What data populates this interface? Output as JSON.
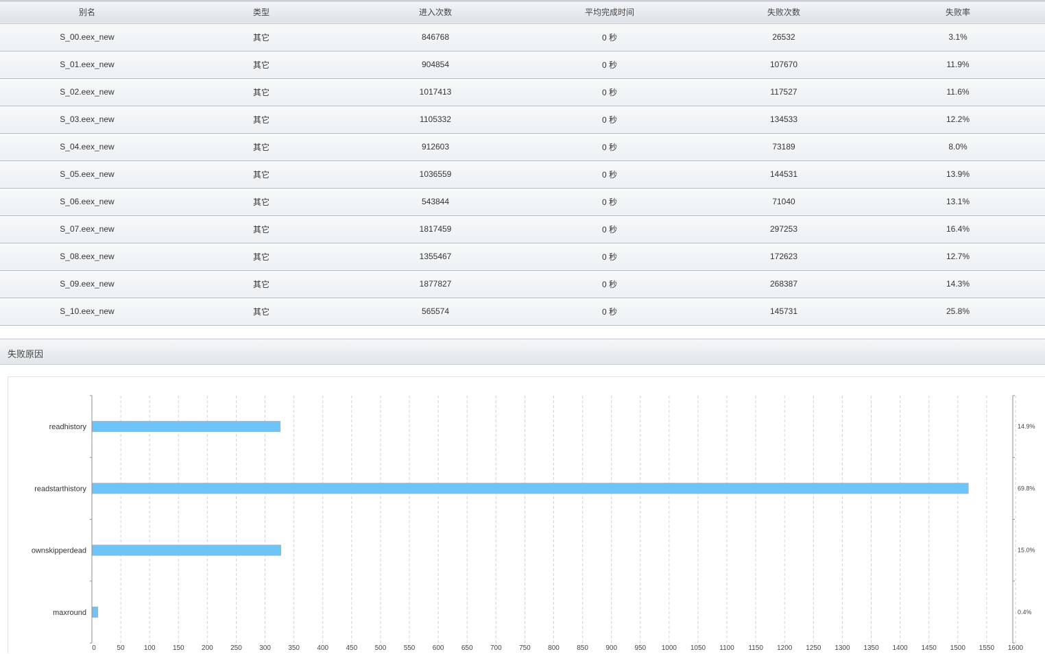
{
  "table": {
    "headers": [
      "别名",
      "类型",
      "进入次数",
      "平均完成时间",
      "失败次数",
      "失败率"
    ],
    "rows": [
      [
        "S_00.eex_new",
        "其它",
        "846768",
        "0 秒",
        "26532",
        "3.1%"
      ],
      [
        "S_01.eex_new",
        "其它",
        "904854",
        "0 秒",
        "107670",
        "11.9%"
      ],
      [
        "S_02.eex_new",
        "其它",
        "1017413",
        "0 秒",
        "117527",
        "11.6%"
      ],
      [
        "S_03.eex_new",
        "其它",
        "1105332",
        "0 秒",
        "134533",
        "12.2%"
      ],
      [
        "S_04.eex_new",
        "其它",
        "912603",
        "0 秒",
        "73189",
        "8.0%"
      ],
      [
        "S_05.eex_new",
        "其它",
        "1036559",
        "0 秒",
        "144531",
        "13.9%"
      ],
      [
        "S_06.eex_new",
        "其它",
        "543844",
        "0 秒",
        "71040",
        "13.1%"
      ],
      [
        "S_07.eex_new",
        "其它",
        "1817459",
        "0 秒",
        "297253",
        "16.4%"
      ],
      [
        "S_08.eex_new",
        "其它",
        "1355467",
        "0 秒",
        "172623",
        "12.7%"
      ],
      [
        "S_09.eex_new",
        "其它",
        "1877827",
        "0 秒",
        "268387",
        "14.3%"
      ],
      [
        "S_10.eex_new",
        "其它",
        "565574",
        "0 秒",
        "145731",
        "25.8%"
      ]
    ]
  },
  "section": {
    "title": "失败原因"
  },
  "chart_data": {
    "type": "bar",
    "orientation": "horizontal",
    "categories": [
      "readhistory",
      "readstarthistory",
      "ownskipperdead",
      "maxround"
    ],
    "values": [
      325,
      1517,
      326,
      9
    ],
    "percent_labels": [
      "14.9%",
      "69.8%",
      "15.0%",
      "0.4%"
    ],
    "xlim": [
      0,
      1600
    ],
    "xticks": [
      0,
      50,
      100,
      150,
      200,
      250,
      300,
      350,
      400,
      450,
      500,
      550,
      600,
      650,
      700,
      750,
      800,
      850,
      900,
      950,
      1000,
      1050,
      1100,
      1150,
      1200,
      1250,
      1300,
      1350,
      1400,
      1450,
      1500,
      1550,
      1600
    ],
    "grid": true,
    "bar_color": "#6cc4f8"
  }
}
